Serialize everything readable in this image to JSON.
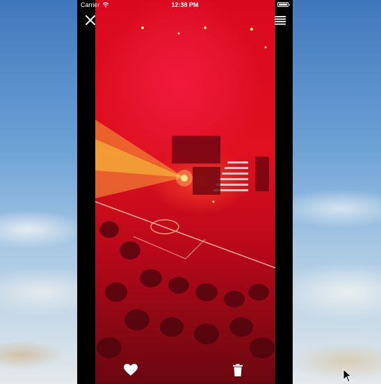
{
  "status_bar": {
    "carrier": "Carrier",
    "time": "12:38 PM"
  },
  "viewer": {
    "image_subject": "concert-stage-red-lights",
    "close_icon": "close-icon",
    "menu_icon": "hamburger-menu-icon",
    "like_icon": "heart-icon",
    "delete_icon": "trash-icon"
  },
  "colors": {
    "photo_red": "#e0101f",
    "laser_yellow": "#f7c23a",
    "frame_black": "#000000"
  }
}
